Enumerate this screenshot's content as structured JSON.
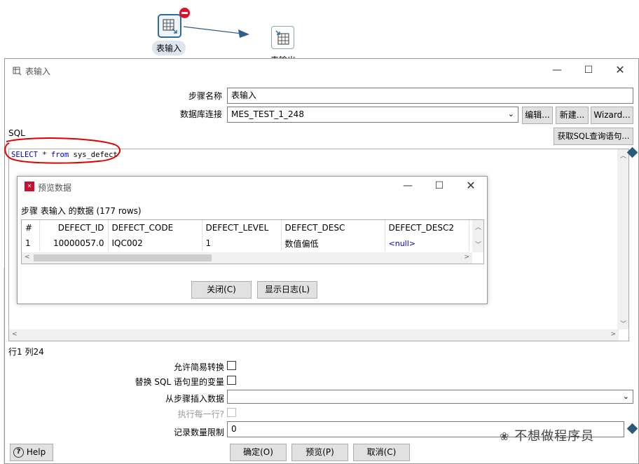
{
  "canvas": {
    "step1_label": "表输入",
    "step2_label": "表输出"
  },
  "dialog": {
    "title": "表输入",
    "step_name_label": "步骤名称",
    "step_name_value": "表输入",
    "db_conn_label": "数据库连接",
    "db_conn_value": "MES_TEST_1_248",
    "edit_button": "编辑...",
    "new_button": "新建...",
    "wizard_button": "Wizard...",
    "sql_label": "SQL",
    "get_sql_button": "获取SQL查询语句...",
    "sql_keyword1": "SELECT",
    "sql_rest1": " * ",
    "sql_keyword2": "from",
    "sql_rest2": " sys_defect",
    "position_status": "行1 列24",
    "allow_lazy_label": "允许简易转换",
    "replace_vars_label": "替换 SQL 语句里的变量",
    "insert_from_step_label": "从步骤插入数据",
    "execute_each_row_label": "执行每一行?",
    "limit_label": "记录数量限制",
    "limit_value": "0",
    "help_button": "Help",
    "ok_button": "确定(O)",
    "preview_button": "预览(P)",
    "cancel_button": "取消(C)"
  },
  "preview": {
    "title": "预览数据",
    "caption": "步骤 表输入 的数据  (177 rows)",
    "columns": [
      "#",
      "DEFECT_ID",
      "DEFECT_CODE",
      "DEFECT_LEVEL",
      "DEFECT_DESC",
      "DEFECT_DESC2"
    ],
    "rows": [
      [
        "1",
        "10000057.0",
        "IQC002",
        "1",
        "数值偏低",
        "<null>"
      ]
    ],
    "close_button": "关闭(C)",
    "log_button": "显示日志(L)"
  },
  "watermark": "不想做程序员",
  "colors": {
    "accent_blue": "#2e6b9e",
    "sql_keyword": "#0000c0",
    "annotation_red": "#e00000",
    "null_blue": "#0000c0"
  }
}
